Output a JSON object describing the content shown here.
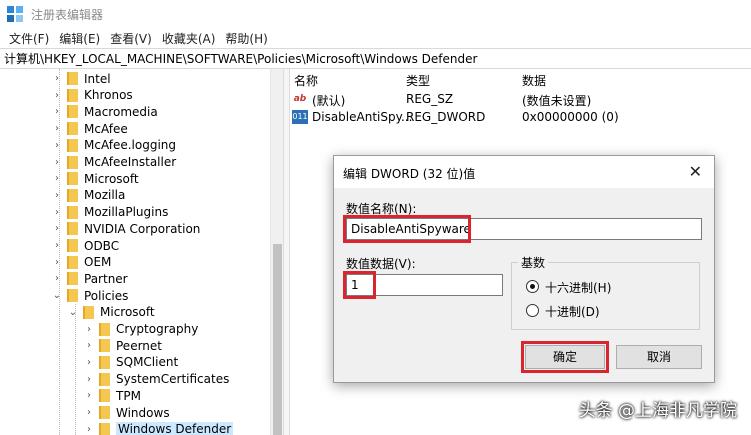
{
  "window": {
    "title": "注册表编辑器"
  },
  "menu": [
    "文件(F)",
    "编辑(E)",
    "查看(V)",
    "收藏夹(A)",
    "帮助(H)"
  ],
  "address": "计算机\\HKEY_LOCAL_MACHINE\\SOFTWARE\\Policies\\Microsoft\\Windows Defender",
  "tree": [
    {
      "label": "Intel",
      "expanded": false
    },
    {
      "label": "Khronos",
      "expanded": false
    },
    {
      "label": "Macromedia",
      "expanded": false
    },
    {
      "label": "McAfee",
      "expanded": false
    },
    {
      "label": "McAfee.logging",
      "expanded": false
    },
    {
      "label": "McAfeeInstaller",
      "expanded": false
    },
    {
      "label": "Microsoft",
      "expanded": false
    },
    {
      "label": "Mozilla",
      "expanded": false
    },
    {
      "label": "MozillaPlugins",
      "expanded": false
    },
    {
      "label": "NVIDIA Corporation",
      "expanded": false
    },
    {
      "label": "ODBC",
      "expanded": false
    },
    {
      "label": "OEM",
      "expanded": false
    },
    {
      "label": "Partner",
      "expanded": false
    },
    {
      "label": "Policies",
      "expanded": true
    },
    {
      "label": "Microsoft",
      "expanded": true
    },
    {
      "label": "Cryptography",
      "expanded": false
    },
    {
      "label": "Peernet",
      "expanded": false
    },
    {
      "label": "SQMClient",
      "expanded": false
    },
    {
      "label": "SystemCertificates",
      "expanded": false
    },
    {
      "label": "TPM",
      "expanded": false
    },
    {
      "label": "Windows",
      "expanded": false
    },
    {
      "label": "Windows Defender",
      "expanded": false,
      "selected": true
    }
  ],
  "values_pane": {
    "columns": {
      "name": "名称",
      "type": "类型",
      "data": "数据"
    },
    "rows": [
      {
        "icon": "string-value-icon",
        "name": "(默认)",
        "type": "REG_SZ",
        "data": "(数值未设置)"
      },
      {
        "icon": "binary-value-icon",
        "name": "DisableAntiSpy...",
        "type": "REG_DWORD",
        "data": "0x00000000 (0)"
      }
    ]
  },
  "dialog": {
    "title": "编辑 DWORD (32 位)值",
    "value_name_label": "数值名称(N):",
    "value_name": "DisableAntiSpyware",
    "value_data_label": "数值数据(V):",
    "value_data": "1",
    "radix_label": "基数",
    "radix_hex": "十六进制(H)",
    "radix_dec": "十进制(D)",
    "radix_selected": "hex",
    "ok_label": "确定",
    "cancel_label": "取消",
    "highlight_color": "#d9262e"
  },
  "watermark": "头条 @上海非凡学院"
}
